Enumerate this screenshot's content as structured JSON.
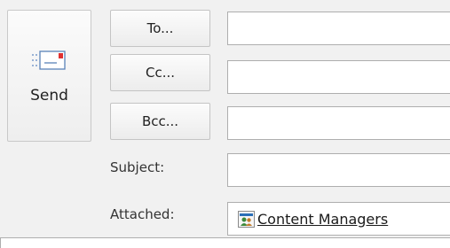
{
  "send": {
    "label": "Send",
    "icon": "send-envelope-icon"
  },
  "address": {
    "to_label": "To...",
    "cc_label": "Cc...",
    "bcc_label": "Bcc...",
    "to_value": "",
    "cc_value": "",
    "bcc_value": ""
  },
  "subject": {
    "label": "Subject:",
    "value": ""
  },
  "attached": {
    "label": "Attached:",
    "items": [
      {
        "name": "Content Managers",
        "icon": "contact-group-icon"
      }
    ]
  },
  "colors": {
    "background": "#f1f1f1",
    "field_border": "#aeaeae",
    "envelope_flag": "#e03030",
    "icon_blue": "#2a6fb8"
  }
}
